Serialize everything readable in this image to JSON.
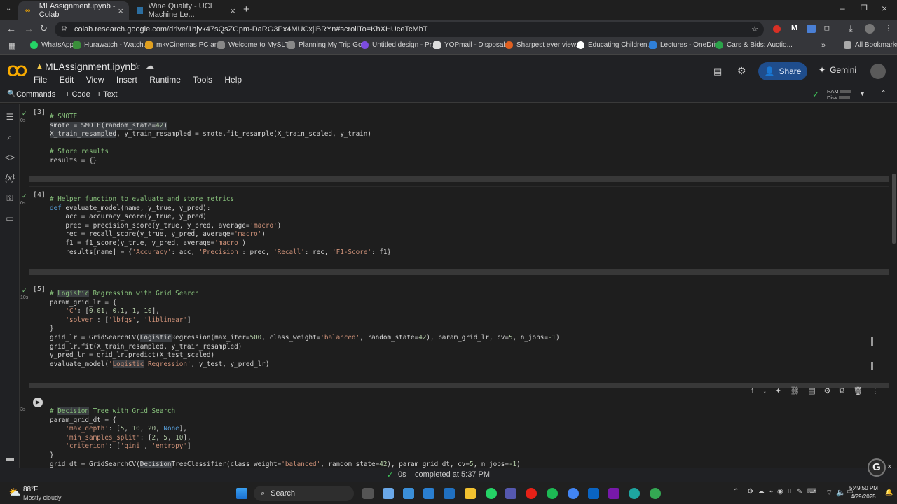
{
  "tabs": [
    {
      "title": "MLAssignment.ipynb - Colab"
    },
    {
      "title": "Wine Quality - UCI Machine Le..."
    }
  ],
  "url": "colab.research.google.com/drive/1hjvk47sQsZGpm-DaRG3Px4MUCxjiBRYn#scrollTo=KhXHUceTcMbT",
  "bookmarks": [
    "WhatsApp",
    "Hurawatch - Watch...",
    "mkvCinemas PC an...",
    "Welcome to MySLT...",
    "Planning My Trip Go...",
    "Untitled design - Pr...",
    "YOPmail - Disposab...",
    "Sharpest ever view...",
    "Educating Children...",
    "Lectures - OneDrive",
    "Cars & Bids: Auctio..."
  ],
  "all_bookmarks": "All Bookmarks",
  "notebook": {
    "title": "MLAssignment.ipynb",
    "menu": [
      "File",
      "Edit",
      "View",
      "Insert",
      "Runtime",
      "Tools",
      "Help"
    ],
    "share": "Share",
    "gemini": "Gemini"
  },
  "toolbar": {
    "commands": "Commands",
    "code": "+ Code",
    "text": "+ Text",
    "ram": "RAM",
    "disk": "Disk"
  },
  "cells": [
    {
      "num": "[3]",
      "time": "0s"
    },
    {
      "num": "[4]",
      "time": "0s"
    },
    {
      "num": "[5]",
      "time": "10s"
    },
    {
      "num": "",
      "time": "3s"
    }
  ],
  "status": {
    "time": "0s",
    "text": "completed at 5:37 PM"
  },
  "taskbar": {
    "temp": "88°F",
    "weather": "Mostly cloudy",
    "search": "Search",
    "clock": "5:49:50 PM",
    "date": "4/29/2025"
  },
  "colors": {
    "accent": "#1a73e8",
    "share_bg": "#1f4d8c"
  }
}
